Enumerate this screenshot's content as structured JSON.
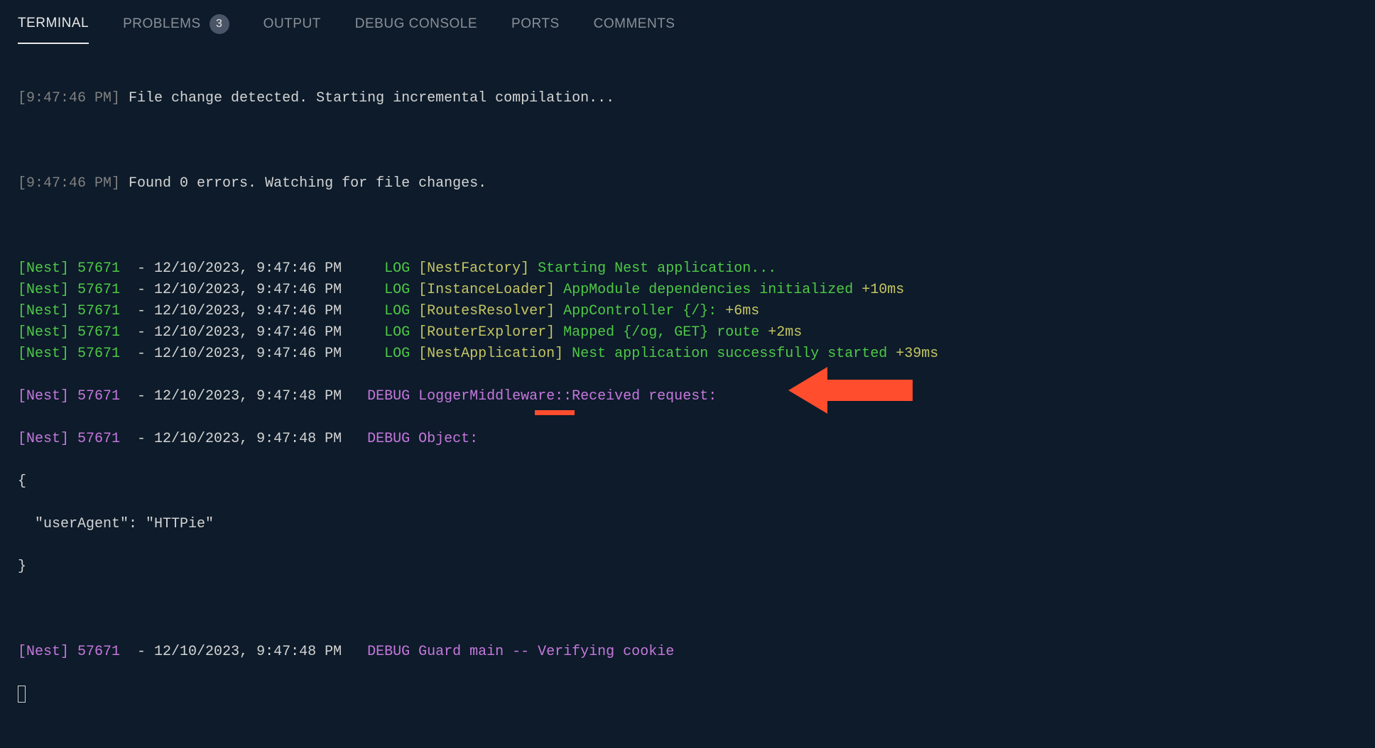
{
  "tabs": {
    "terminal": "TERMINAL",
    "problems": "PROBLEMS",
    "problems_count": "3",
    "output": "OUTPUT",
    "debug_console": "DEBUG CONSOLE",
    "ports": "PORTS",
    "comments": "COMMENTS"
  },
  "log": {
    "line1_ts": "[9:47:46 PM]",
    "line1_msg": " File change detected. Starting incremental compilation...",
    "line2_ts": "[9:47:46 PM]",
    "line2_msg": " Found 0 errors. Watching for file changes.",
    "nest_lines": [
      {
        "prefix": "[Nest] 57671",
        "dash": "  - ",
        "time": "12/10/2023, 9:47:46 PM",
        "pad": "     ",
        "level": "LOG",
        "ctx": " [NestFactory]",
        "msg": " Starting Nest application...",
        "suffix": ""
      },
      {
        "prefix": "[Nest] 57671",
        "dash": "  - ",
        "time": "12/10/2023, 9:47:46 PM",
        "pad": "     ",
        "level": "LOG",
        "ctx": " [InstanceLoader]",
        "msg": " AppModule dependencies initialized",
        "suffix": " +10ms"
      },
      {
        "prefix": "[Nest] 57671",
        "dash": "  - ",
        "time": "12/10/2023, 9:47:46 PM",
        "pad": "     ",
        "level": "LOG",
        "ctx": " [RoutesResolver]",
        "msg": " AppController {/}:",
        "suffix": " +6ms"
      },
      {
        "prefix": "[Nest] 57671",
        "dash": "  - ",
        "time": "12/10/2023, 9:47:46 PM",
        "pad": "     ",
        "level": "LOG",
        "ctx": " [RouterExplorer]",
        "msg": " Mapped {/og, GET} route",
        "suffix": " +2ms"
      },
      {
        "prefix": "[Nest] 57671",
        "dash": "  - ",
        "time": "12/10/2023, 9:47:46 PM",
        "pad": "     ",
        "level": "LOG",
        "ctx": " [NestApplication]",
        "msg": " Nest application successfully started",
        "suffix": " +39ms"
      }
    ],
    "debug1": {
      "prefix": "[Nest] 57671",
      "dash": "  - ",
      "time": "12/10/2023, 9:47:48 PM",
      "pad": "   ",
      "level": "DEBUG",
      "msg": " LoggerMiddleware::Received request:"
    },
    "debug2": {
      "prefix": "[Nest] 57671",
      "dash": "  - ",
      "time": "12/10/2023, 9:47:48 PM",
      "pad": "   ",
      "level": "DEBUG",
      "msg": " Object:"
    },
    "obj_open": "{",
    "obj_body": "  \"userAgent\": \"HTTPie\"",
    "obj_close": "}",
    "debug3": {
      "prefix": "[Nest] 57671",
      "dash": "  - ",
      "time": "12/10/2023, 9:47:48 PM",
      "pad": "   ",
      "level": "DEBUG",
      "msg1": " Guard ",
      "main": "main",
      "msg2": " -- Verifying cookie"
    }
  }
}
